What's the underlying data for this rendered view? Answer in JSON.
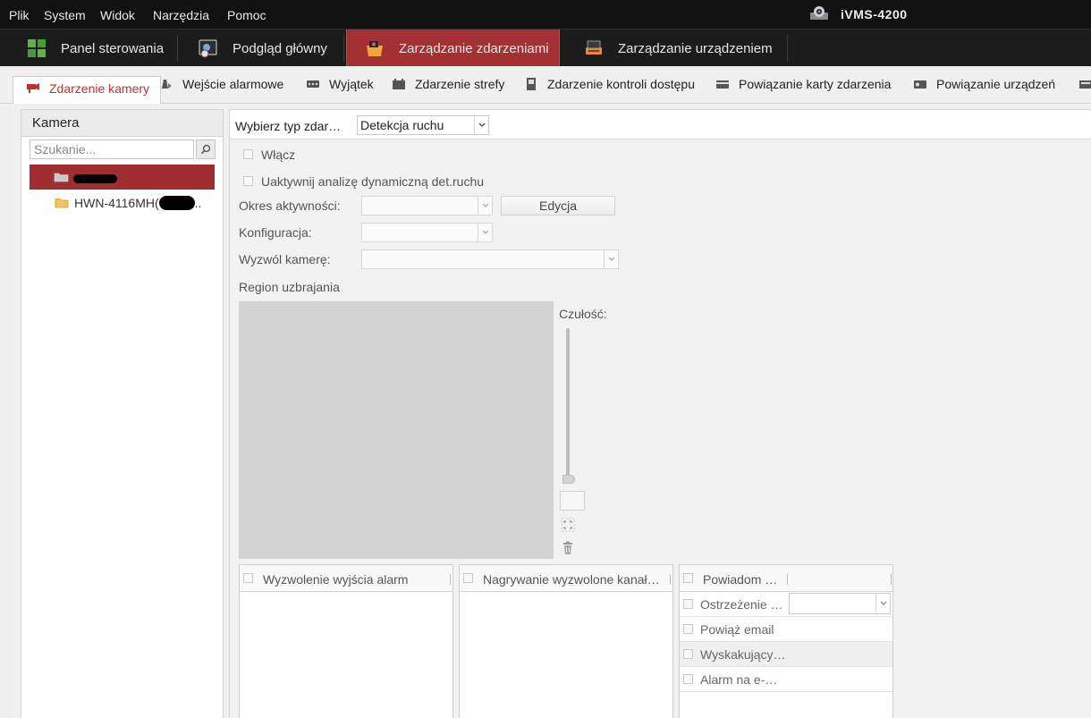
{
  "menu": {
    "items": [
      "Plik",
      "System",
      "Widok",
      "Narzędzia",
      "Pomoc"
    ],
    "app_title": "iVMS-4200"
  },
  "modules": [
    {
      "label": "Panel sterowania",
      "icon": "control-panel-icon"
    },
    {
      "label": "Podgląd główny",
      "icon": "main-view-icon"
    },
    {
      "label": "Zarządzanie zdarzeniami",
      "icon": "event-management-icon",
      "active": true
    },
    {
      "label": "Zarządzanie urządzeniem",
      "icon": "device-management-icon"
    }
  ],
  "subtabs": [
    {
      "label": "Zdarzenie kamery",
      "icon": "camera-icon",
      "active": true
    },
    {
      "label": "Wejście alarmowe",
      "icon": "alarm-input-icon"
    },
    {
      "label": "Wyjątek",
      "icon": "exception-icon"
    },
    {
      "label": "Zdarzenie strefy",
      "icon": "zone-event-icon"
    },
    {
      "label": "Zdarzenie kontroli dostępu",
      "icon": "access-control-icon"
    },
    {
      "label": "Powiązanie karty zdarzenia",
      "icon": "card-linkage-icon"
    },
    {
      "label": "Powiązanie urządzeń",
      "icon": "device-linkage-icon"
    }
  ],
  "left_panel": {
    "title": "Kamera",
    "search_placeholder": "Szukanie...",
    "tree": [
      {
        "label": "",
        "selected": true
      },
      {
        "label": "HWN-4116MH(",
        "suffix": ".."
      }
    ]
  },
  "config": {
    "event_type_label": "Wybierz typ zdar…",
    "event_type_value": "Detekcja ruchu",
    "enable_label": "Włącz",
    "dynamic_analysis_label": "Uaktywnij analizę dynamiczną det.ruchu",
    "schedule_label": "Okres aktywności:",
    "edit_button": "Edycja",
    "configuration_label": "Konfiguracja:",
    "trigger_camera_label": "Wyzwól kamerę:",
    "arming_region_label": "Region uzbrajania",
    "sensitivity_label": "Czułość:"
  },
  "linkage": {
    "alarm_output_header": "Wyzwolenie wyjścia alarm",
    "recording_header": "Nagrywanie wyzwolone kanał…",
    "notify_header": "Powiadom …",
    "notify_rows": [
      "Ostrzeżenie …",
      "Powiąż email",
      "Wyskakujący…",
      "Alarm na e-…"
    ]
  },
  "colors": {
    "accent": "#a33032",
    "menubar_bg": "#111111",
    "active_subtab_text": "#c0302f"
  }
}
